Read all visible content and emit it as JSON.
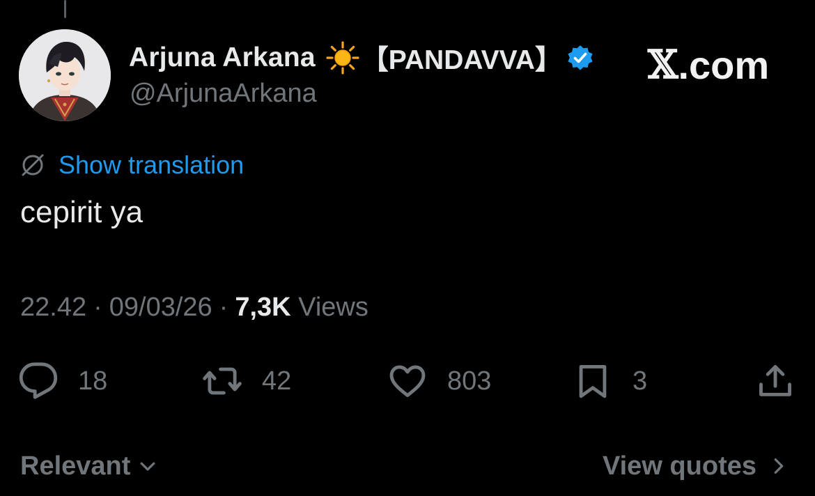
{
  "author": {
    "display_name": "Arjuna Arkana",
    "affiliation": "【PANDAVVA】",
    "handle": "@ArjunaArkana",
    "avatar_icon": "anime-avatar-icon",
    "sun_icon": "sun-icon",
    "verified_icon": "verified-badge-icon"
  },
  "brand": {
    "mark": "𝕏",
    "text": ".com"
  },
  "translation": {
    "icon": "globe-slash-icon",
    "label": "Show translation"
  },
  "tweet": {
    "text": "cepirit ya"
  },
  "meta": {
    "time": "22.42",
    "separator": "·",
    "date": "09/03/26",
    "views_count": "7,3K",
    "views_label": "Views"
  },
  "actions": {
    "replies": {
      "icon": "reply-icon",
      "count": "18"
    },
    "reposts": {
      "icon": "repost-icon",
      "count": "42"
    },
    "likes": {
      "icon": "heart-icon",
      "count": "803"
    },
    "bookmarks": {
      "icon": "bookmark-icon",
      "count": "3"
    },
    "share": {
      "icon": "share-icon"
    }
  },
  "footer": {
    "sort_label": "Relevant",
    "view_quotes_label": "View quotes"
  },
  "colors": {
    "background": "#000000",
    "text_primary": "#e7e9ea",
    "text_secondary": "#71767b",
    "link": "#1d9bf0",
    "verified": "#1d9bf0"
  }
}
